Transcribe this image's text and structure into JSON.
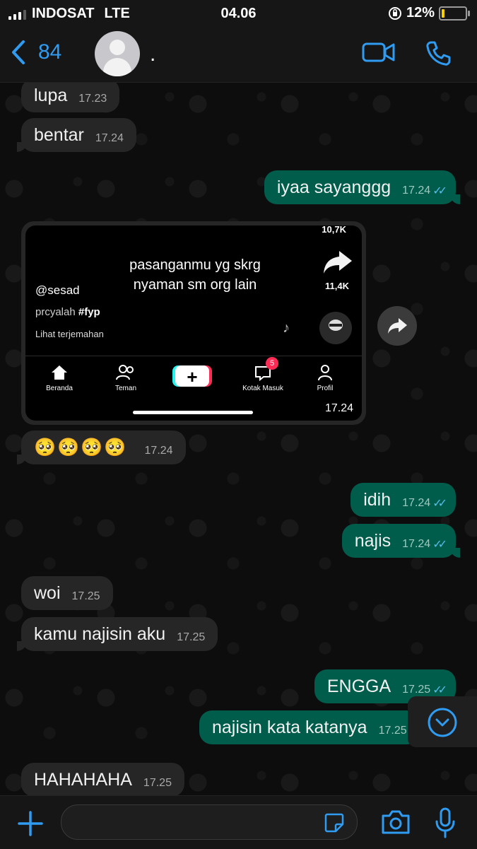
{
  "status_bar": {
    "carrier": "INDOSAT",
    "network": "LTE",
    "time": "04.06",
    "battery": "12%"
  },
  "header": {
    "back_count": "84",
    "contact_name": "."
  },
  "messages": [
    {
      "dir": "in",
      "text": "lupa",
      "time": "17.23"
    },
    {
      "dir": "in",
      "text": "bentar",
      "time": "17.24"
    },
    {
      "dir": "out",
      "text": "iyaa sayanggg",
      "time": "17.24"
    },
    {
      "dir": "in",
      "text": "🥺🥺🥺🥺",
      "time": "17.24"
    },
    {
      "dir": "out",
      "text": "idih",
      "time": "17.24"
    },
    {
      "dir": "out",
      "text": "najis",
      "time": "17.24"
    },
    {
      "dir": "in",
      "text": "woi",
      "time": "17.25"
    },
    {
      "dir": "in",
      "text": "kamu najisin aku",
      "time": "17.25"
    },
    {
      "dir": "out",
      "text": "ENGGA",
      "time": "17.25"
    },
    {
      "dir": "out",
      "text": "najisin kata katanya",
      "time": "17.25"
    },
    {
      "dir": "in",
      "text": "HAHAHAHA",
      "time": "17.25"
    }
  ],
  "media": {
    "time": "17.24",
    "caption_line1": "pasanganmu yg skrg",
    "caption_line2": "nyaman sm org lain",
    "username": "@sesad",
    "description": "prcyalah",
    "hashtag": "#fyp",
    "translate": "Lihat terjemahan",
    "top_count": "10,7K",
    "share_count": "11,4K",
    "nav": {
      "home": "Beranda",
      "friends": "Teman",
      "inbox": "Kotak Masuk",
      "profile": "Profil",
      "inbox_badge": "5"
    }
  }
}
